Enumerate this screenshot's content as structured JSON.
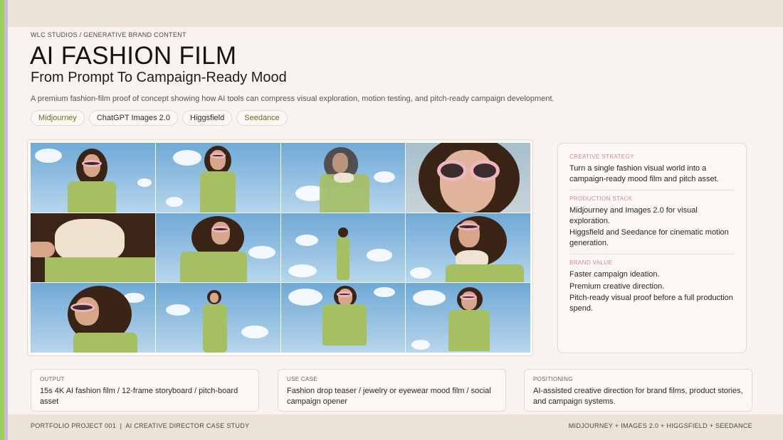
{
  "header": {
    "eyebrow": "WLC STUDIOS / GENERATIVE BRAND CONTENT",
    "title": "AI FASHION FILM",
    "subtitle": "From Prompt To Campaign-Ready Mood",
    "description": "A premium fashion-film proof of concept showing how AI tools can compress visual exploration, motion testing, and pitch-ready campaign development."
  },
  "tags": [
    "Midjourney",
    "ChatGPT Images 2.0",
    "Higgsfield",
    "Seedance"
  ],
  "strategy_card": {
    "creative_strategy_label": "CREATIVE STRATEGY",
    "creative_strategy_text": "Turn a single fashion visual world into a campaign-ready mood film and pitch asset.",
    "production_stack_label": "PRODUCTION STACK",
    "production_stack_items": [
      "Midjourney and Images 2.0 for visual exploration.",
      "Higgsfield and Seedance for cinematic motion generation."
    ],
    "brand_value_label": "BRAND VALUE",
    "brand_value_items": [
      "Faster campaign ideation.",
      "Premium creative direction.",
      "Pitch-ready visual proof before a full production spend."
    ]
  },
  "bottom_cards": {
    "output_label": "OUTPUT",
    "output_text": "15s 4K AI fashion film / 12-frame storyboard / pitch-board asset",
    "use_case_label": "USE CASE",
    "use_case_text": "Fashion drop teaser / jewelry or eyewear mood film / social campaign opener",
    "positioning_label": "POSITIONING",
    "positioning_text": "AI-assisted creative direction for brand films, product stories, and campaign systems."
  },
  "footer": {
    "left": "PORTFOLIO PROJECT 001  |  AI CREATIVE DIRECTOR CASE STUDY",
    "right": "MIDJOURNEY + IMAGES 2.0 + HIGGSFIELD + SEEDANCE"
  },
  "colors": {
    "accent_green": "#9fcf58",
    "accent_lilac": "#c9b8d8",
    "section_label_pink": "#d6859a",
    "knit_green": "#a5bf62",
    "glasses_pink": "#f1b5c0"
  }
}
